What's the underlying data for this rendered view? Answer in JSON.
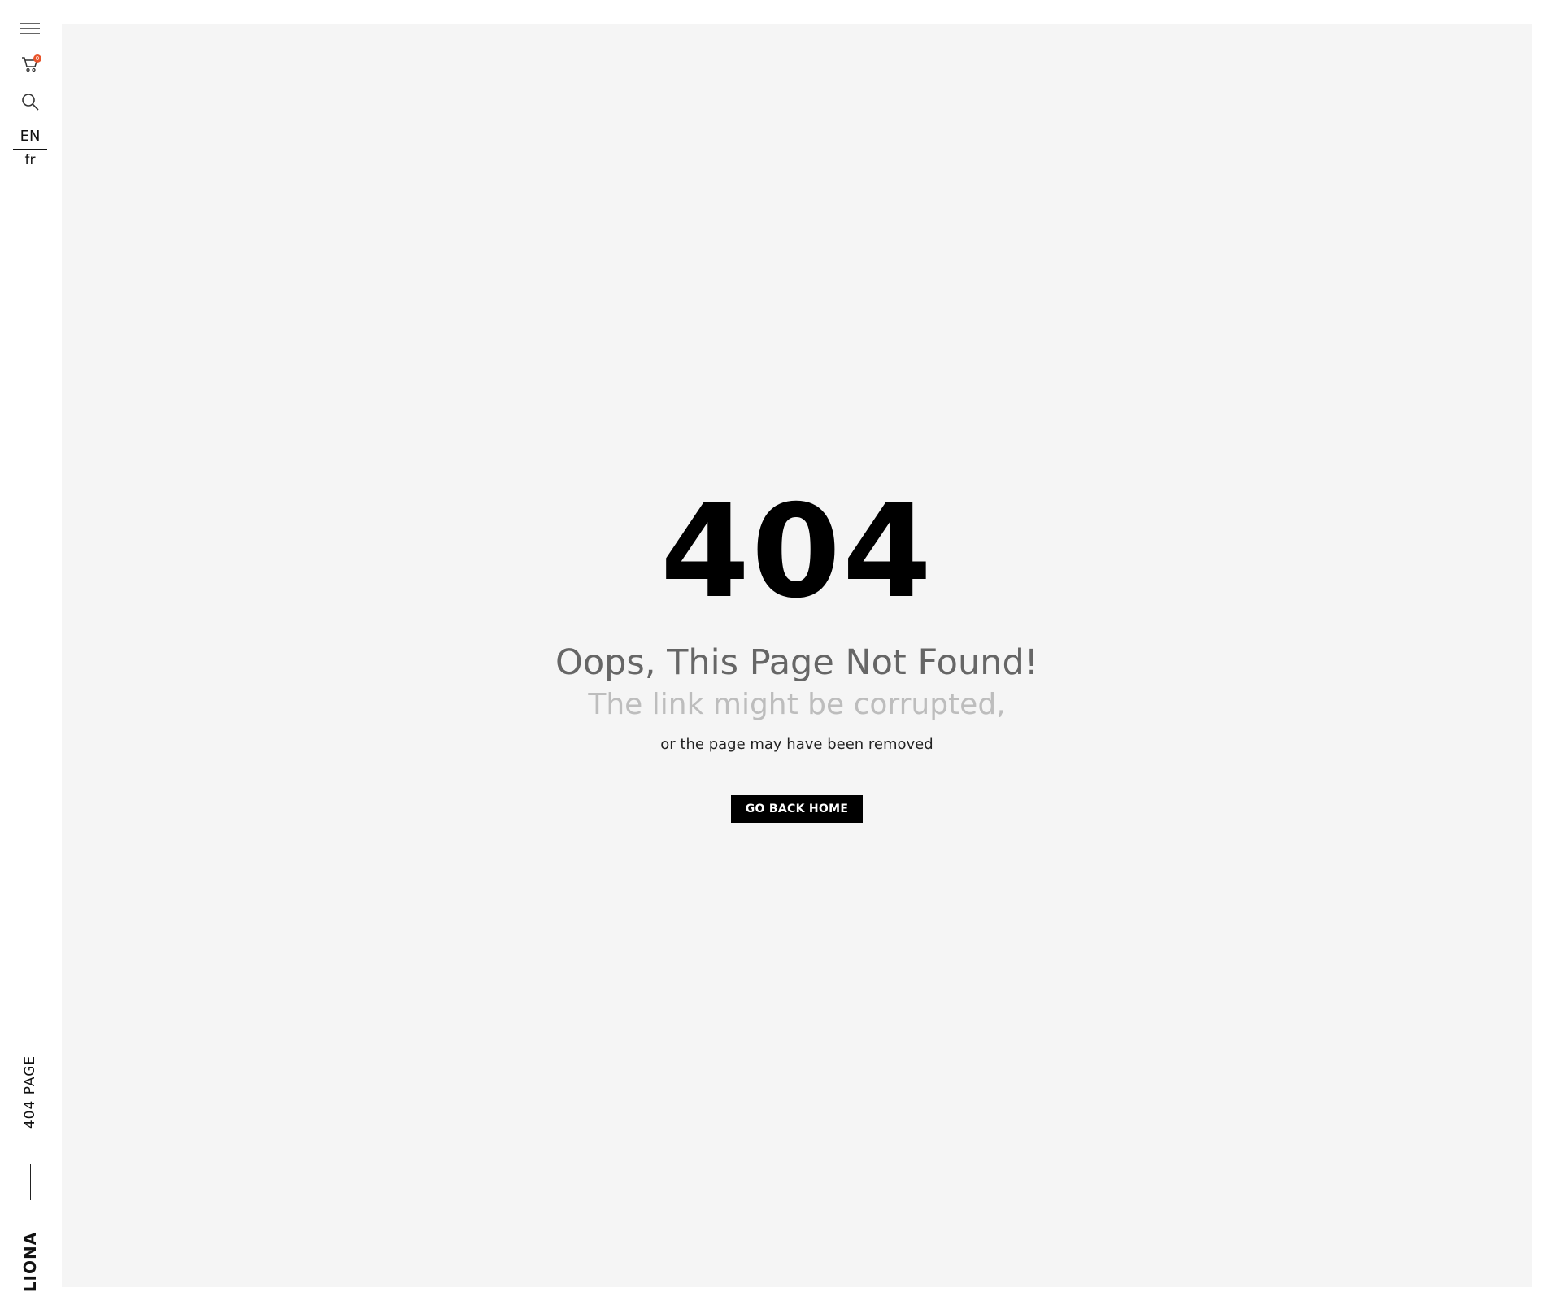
{
  "sidebar": {
    "cart_count": "0",
    "languages": [
      "EN",
      "fr"
    ],
    "page_label": "404 PAGE",
    "brand": "LIONA",
    "icons": [
      "hamburger-menu-icon",
      "cart-icon",
      "search-icon"
    ]
  },
  "error": {
    "code": "404",
    "title": "Oops, This Page Not Found!",
    "subtitle": "The link might be corrupted,",
    "description": "or the page may have been removed",
    "button_label": "GO BACK HOME"
  },
  "colors": {
    "main_bg": "#f5f5f5",
    "badge": "#e8532a",
    "button_bg": "#000000",
    "title": "#666666",
    "subtitle": "#bdbdbd"
  }
}
